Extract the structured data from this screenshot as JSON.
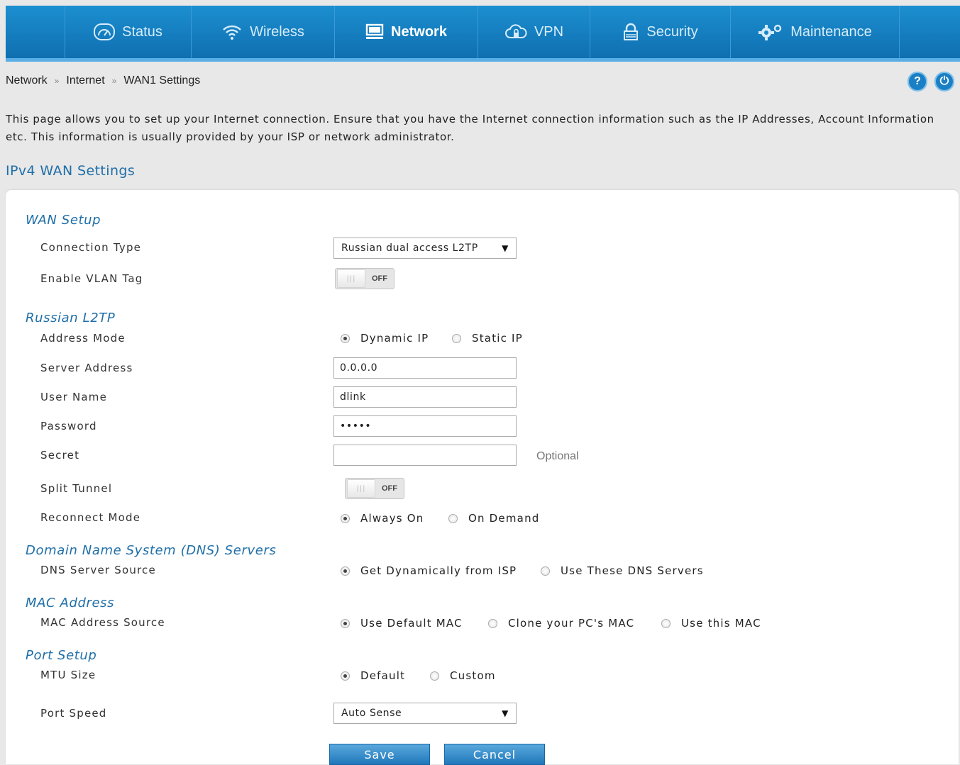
{
  "nav": {
    "items": [
      {
        "label": "Status",
        "icon": "gauge-icon"
      },
      {
        "label": "Wireless",
        "icon": "wifi-icon"
      },
      {
        "label": "Network",
        "icon": "monitor-icon",
        "active": true
      },
      {
        "label": "VPN",
        "icon": "cloud-lock-icon"
      },
      {
        "label": "Security",
        "icon": "lock-icon"
      },
      {
        "label": "Maintenance",
        "icon": "gears-icon"
      }
    ],
    "color": "#1586c8"
  },
  "breadcrumb": [
    "Network",
    "Internet",
    "WAN1 Settings"
  ],
  "breadcrumb_sep": "»",
  "header_icons": {
    "help": "?",
    "logout": "⏻"
  },
  "description": "This page allows you to set up your Internet connection. Ensure that you have the Internet connection information such as the IP Addresses, Account Information etc. This information is usually provided by your ISP or network administrator.",
  "section_title": "IPv4 WAN Settings",
  "groups": {
    "wan_setup": "WAN Setup",
    "russian_l2tp": "Russian L2TP",
    "dns": "Domain Name System (DNS) Servers",
    "mac": "MAC Address",
    "port": "Port Setup"
  },
  "fields": {
    "connection_type": {
      "label": "Connection Type",
      "value": "Russian dual access L2TP"
    },
    "vlan_tag": {
      "label": "Enable VLAN Tag",
      "state": "OFF"
    },
    "address_mode": {
      "label": "Address Mode",
      "options": [
        "Dynamic IP",
        "Static IP"
      ],
      "selected": "Dynamic IP"
    },
    "server_address": {
      "label": "Server Address",
      "value": "0.0.0.0"
    },
    "user_name": {
      "label": "User Name",
      "value": "dlink"
    },
    "password": {
      "label": "Password",
      "value": "•••••"
    },
    "secret": {
      "label": "Secret",
      "value": "",
      "hint": "Optional"
    },
    "split_tunnel": {
      "label": "Split Tunnel",
      "state": "OFF"
    },
    "reconnect_mode": {
      "label": "Reconnect Mode",
      "options": [
        "Always On",
        "On Demand"
      ],
      "selected": "Always On"
    },
    "dns_source": {
      "label": "DNS Server Source",
      "options": [
        "Get Dynamically from ISP",
        "Use These DNS Servers"
      ],
      "selected": "Get Dynamically from ISP"
    },
    "mac_source": {
      "label": "MAC Address Source",
      "options": [
        "Use Default MAC",
        "Clone your PC's MAC",
        "Use this MAC"
      ],
      "selected": "Use Default MAC"
    },
    "mtu_size": {
      "label": "MTU Size",
      "options": [
        "Default",
        "Custom"
      ],
      "selected": "Default"
    },
    "port_speed": {
      "label": "Port Speed",
      "value": "Auto Sense"
    }
  },
  "buttons": {
    "save": "Save",
    "cancel": "Cancel"
  }
}
